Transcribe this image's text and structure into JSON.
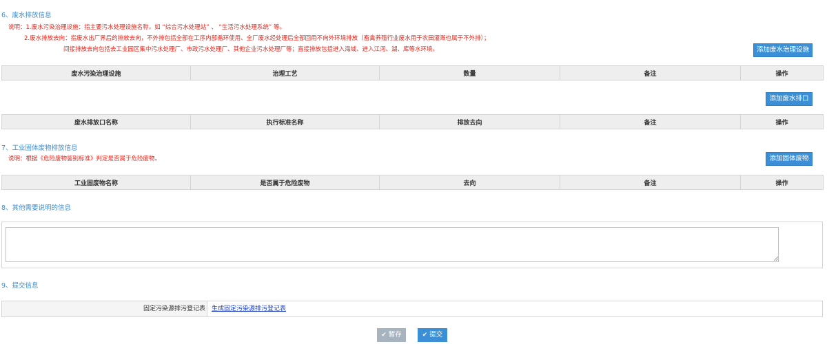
{
  "section6": {
    "title": "6、废水排放信息",
    "note_line1": "说明：1.废水污染治理设施：指主要污水处理设施名称，如 “综合污水处理站” 、 “生活污水处理系统” 等。",
    "note_line2": "2.废水排放去向：指废水出厂界后的排放去向，不外排包括全部在工序内部循环使用、全厂废水经处理后全部回用不向外环境排放（畜禽养殖行业废水用于农田灌溉也属于不外排）；",
    "note_line3": "间接排放去向包括去工业园区集中污水处理厂、市政污水处理厂、其他企业污水处理厂等；直接排放包括进入海域、进入江河、湖、库等水环境。",
    "add_facility_label": "添加废水治理设施",
    "facility_columns": [
      "废水污染治理设施",
      "治理工艺",
      "数量",
      "备注",
      "操作"
    ],
    "add_outlet_label": "添加废水排口",
    "outlet_columns": [
      "废水排放口名称",
      "执行标准名称",
      "排放去向",
      "备注",
      "操作"
    ]
  },
  "section7": {
    "title": "7、工业固体废物排放信息",
    "note": "说明：根据《危险废物鉴别标准》判定是否属于危险废物。",
    "add_label": "添加固体废物",
    "columns": [
      "工业固废物名称",
      "是否属于危险废物",
      "去向",
      "备注",
      "操作"
    ]
  },
  "section8": {
    "title": "8、其他需要说明的信息",
    "textarea_value": ""
  },
  "section9": {
    "title": "9、提交信息",
    "row_label": "固定污染源排污登记表",
    "link_text": "生成固定污染源排污登记表"
  },
  "actions": {
    "save_label": "暂存",
    "submit_label": "提交",
    "save_color": "#a7b3bf",
    "submit_color": "#3a8fd6"
  }
}
